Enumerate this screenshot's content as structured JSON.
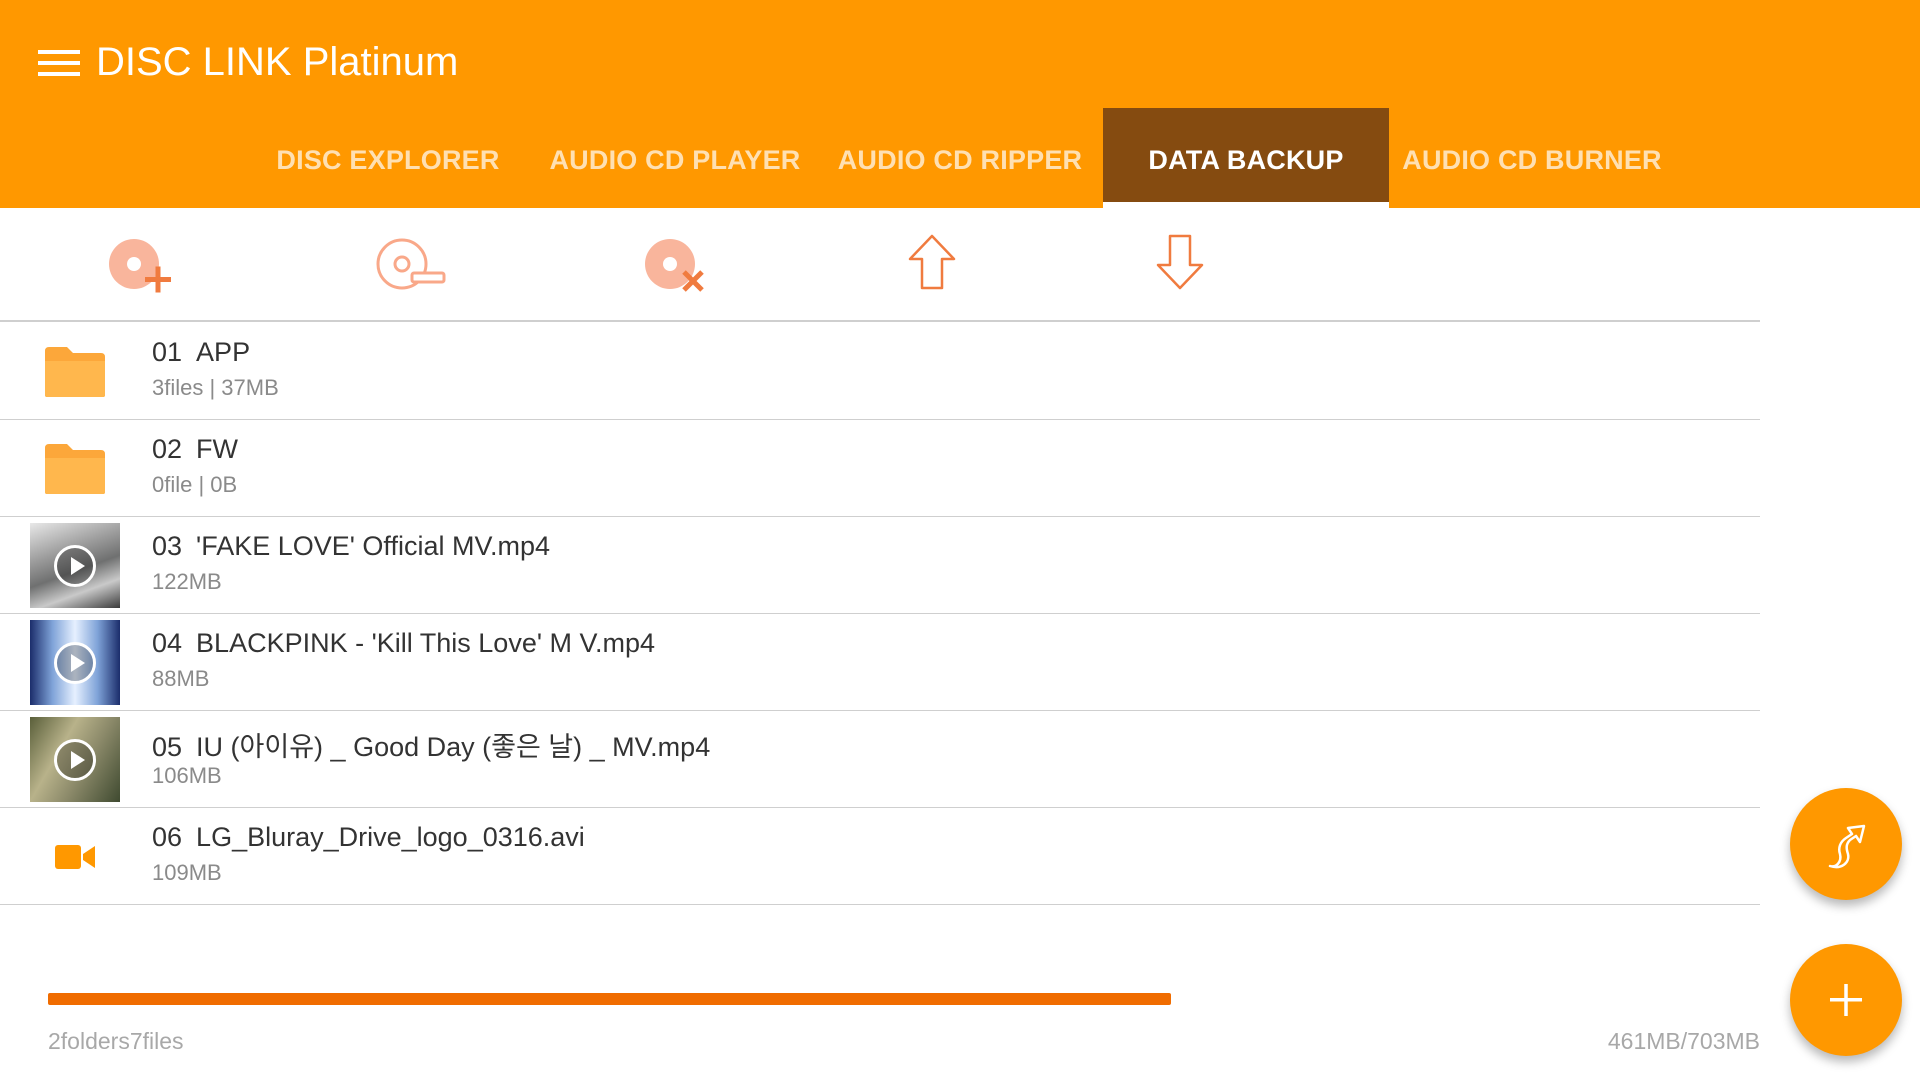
{
  "app": {
    "title": "DISC LINK Platinum"
  },
  "tabs": [
    {
      "label": "DISC EXPLORER"
    },
    {
      "label": "AUDIO CD PLAYER"
    },
    {
      "label": "AUDIO CD RIPPER"
    },
    {
      "label": "DATA BACKUP",
      "active": true
    },
    {
      "label": "AUDIO CD BURNER"
    }
  ],
  "toolbar": {
    "icons": [
      "add-to-disc-icon",
      "remove-from-disc-icon",
      "delete-disc-icon",
      "move-up-icon",
      "move-down-icon"
    ]
  },
  "files": [
    {
      "index": "01",
      "name": "APP",
      "detail": "3files | 37MB",
      "type": "folder",
      "icon": "folder-icon"
    },
    {
      "index": "02",
      "name": "FW",
      "detail": "0file | 0B",
      "type": "folder",
      "icon": "folder-icon"
    },
    {
      "index": "03",
      "name": "'FAKE LOVE' Official MV.mp4",
      "detail": "122MB",
      "type": "video",
      "icon": "video-thumbnail"
    },
    {
      "index": "04",
      "name": "BLACKPINK - 'Kill This Love' M V.mp4",
      "detail": "88MB",
      "type": "video",
      "icon": "video-thumbnail"
    },
    {
      "index": "05",
      "name": "IU (아이유) _ Good Day (좋은 날) _ MV.mp4",
      "detail": "106MB",
      "type": "video",
      "icon": "video-thumbnail"
    },
    {
      "index": "06",
      "name": "LG_Bluray_Drive_logo_0316.avi",
      "detail": "109MB",
      "type": "video-file",
      "icon": "video-camera-icon"
    }
  ],
  "summary": {
    "counts": "2folders7files",
    "usage": "461MB/703MB",
    "progress_fraction": 0.656
  },
  "colors": {
    "primary": "#ff9800",
    "active_tab": "#854b10",
    "progress": "#f06c00",
    "icon_accent": "#f07b3f"
  }
}
